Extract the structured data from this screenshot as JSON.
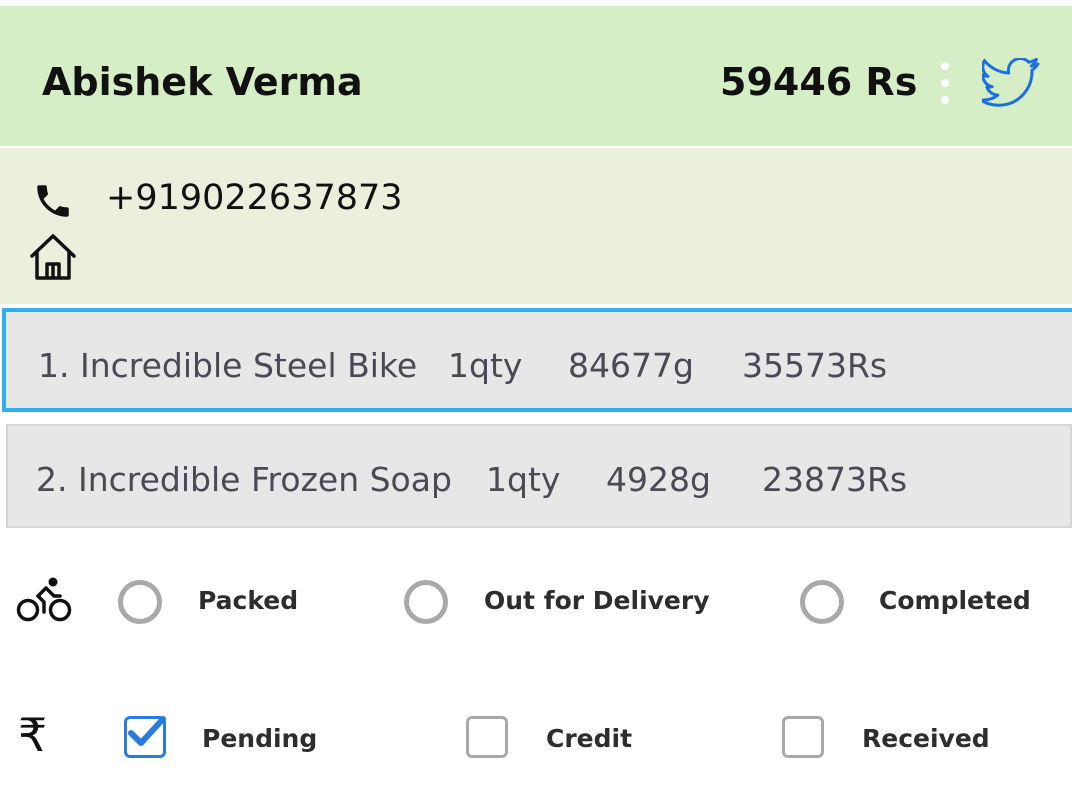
{
  "header": {
    "customer_name": "Abishek Verma",
    "total": "59446 Rs",
    "background": "#d5eec6",
    "more_icon": "more-vert-icon",
    "share_icon": "twitter-icon"
  },
  "contact": {
    "phone": "+919022637873",
    "phone_icon": "phone-icon",
    "address_icon": "home-icon",
    "background": "#ebf0dc"
  },
  "items": [
    {
      "index": "1.",
      "name": "Incredible Steel Bike",
      "qty": "1qty",
      "weight": "84677g",
      "price": "35573Rs",
      "selected": true
    },
    {
      "index": "2.",
      "name": "Incredible Frozen Soap",
      "qty": "1qty",
      "weight": "4928g",
      "price": "23873Rs",
      "selected": false
    }
  ],
  "delivery_status": {
    "icon": "bicycle-icon",
    "options": [
      {
        "label": "Packed",
        "selected": false
      },
      {
        "label": "Out for Delivery",
        "selected": false
      },
      {
        "label": "Completed",
        "selected": false
      }
    ]
  },
  "payment_status": {
    "icon": "₹",
    "options": [
      {
        "label": "Pending",
        "checked": true
      },
      {
        "label": "Credit",
        "checked": false
      },
      {
        "label": "Received",
        "checked": false
      }
    ]
  },
  "colors": {
    "accent": "#2fb0ec",
    "checkbox_checked": "#2a7be0",
    "twitter": "#1d9bf0"
  }
}
